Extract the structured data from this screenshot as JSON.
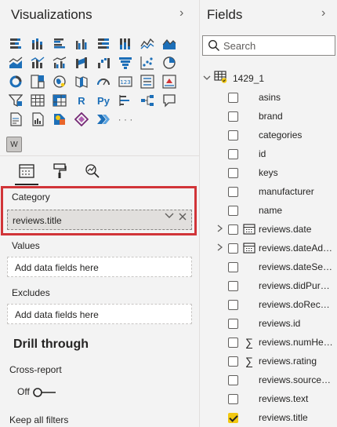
{
  "visualizations": {
    "title": "Visualizations",
    "icons": [
      "stacked-bar-icon",
      "stacked-column-icon",
      "clustered-bar-icon",
      "clustered-column-icon",
      "100-stacked-bar-icon",
      "100-stacked-column-icon",
      "line-chart-icon",
      "area-chart-icon",
      "stacked-area-icon",
      "line-and-stacked-column-icon",
      "line-and-clustered-column-icon",
      "ribbon-chart-icon",
      "waterfall-icon",
      "funnel-icon",
      "scatter-chart-icon",
      "pie-chart-icon",
      "donut-chart-icon",
      "treemap-icon",
      "map-icon",
      "filled-map-icon",
      "gauge-icon",
      "card-icon",
      "multi-row-card-icon",
      "kpi-icon",
      "slicer-icon",
      "table-icon",
      "matrix-icon",
      "r-visual-icon",
      "python-visual-icon",
      "key-influencers-icon",
      "decomposition-tree-icon",
      "qa-icon",
      "smart-narrative-icon",
      "paginated-report-icon",
      "arcgis-icon",
      "power-apps-icon",
      "power-automate-icon",
      "more-visuals-icon"
    ],
    "r_label": "R",
    "py_label": "Py",
    "more_label": "· · ·",
    "custom_visual_label": "W",
    "category_label": "Category",
    "category_value": "reviews.title",
    "values_label": "Values",
    "values_placeholder": "Add data fields here",
    "excludes_label": "Excludes",
    "excludes_placeholder": "Add data fields here",
    "drill_through_title": "Drill through",
    "cross_report_label": "Cross-report",
    "cross_report_state": "Off",
    "keep_filters_label": "Keep all filters"
  },
  "fields": {
    "title": "Fields",
    "search_placeholder": "Search",
    "table_name": "1429_1",
    "items": [
      {
        "label": "asins",
        "checked": false,
        "type": "",
        "expandable": false
      },
      {
        "label": "brand",
        "checked": false,
        "type": "",
        "expandable": false
      },
      {
        "label": "categories",
        "checked": false,
        "type": "",
        "expandable": false
      },
      {
        "label": "id",
        "checked": false,
        "type": "",
        "expandable": false
      },
      {
        "label": "keys",
        "checked": false,
        "type": "",
        "expandable": false
      },
      {
        "label": "manufacturer",
        "checked": false,
        "type": "",
        "expandable": false
      },
      {
        "label": "name",
        "checked": false,
        "type": "",
        "expandable": false
      },
      {
        "label": "reviews.date",
        "checked": false,
        "type": "date",
        "expandable": true
      },
      {
        "label": "reviews.dateAdd...",
        "checked": false,
        "type": "date",
        "expandable": true
      },
      {
        "label": "reviews.dateSeen",
        "checked": false,
        "type": "",
        "expandable": false
      },
      {
        "label": "reviews.didPurch...",
        "checked": false,
        "type": "",
        "expandable": false
      },
      {
        "label": "reviews.doReco...",
        "checked": false,
        "type": "",
        "expandable": false
      },
      {
        "label": "reviews.id",
        "checked": false,
        "type": "",
        "expandable": false
      },
      {
        "label": "reviews.numHel...",
        "checked": false,
        "type": "sum",
        "expandable": false
      },
      {
        "label": "reviews.rating",
        "checked": false,
        "type": "sum",
        "expandable": false
      },
      {
        "label": "reviews.sourceU...",
        "checked": false,
        "type": "",
        "expandable": false
      },
      {
        "label": "reviews.text",
        "checked": false,
        "type": "",
        "expandable": false
      },
      {
        "label": "reviews.title",
        "checked": true,
        "type": "",
        "expandable": false
      }
    ]
  },
  "colors": {
    "highlight": "#d13438",
    "checked": "#f2c811",
    "accent_blue": "#1d6fb8",
    "panel_bg": "#f3f3f3"
  }
}
